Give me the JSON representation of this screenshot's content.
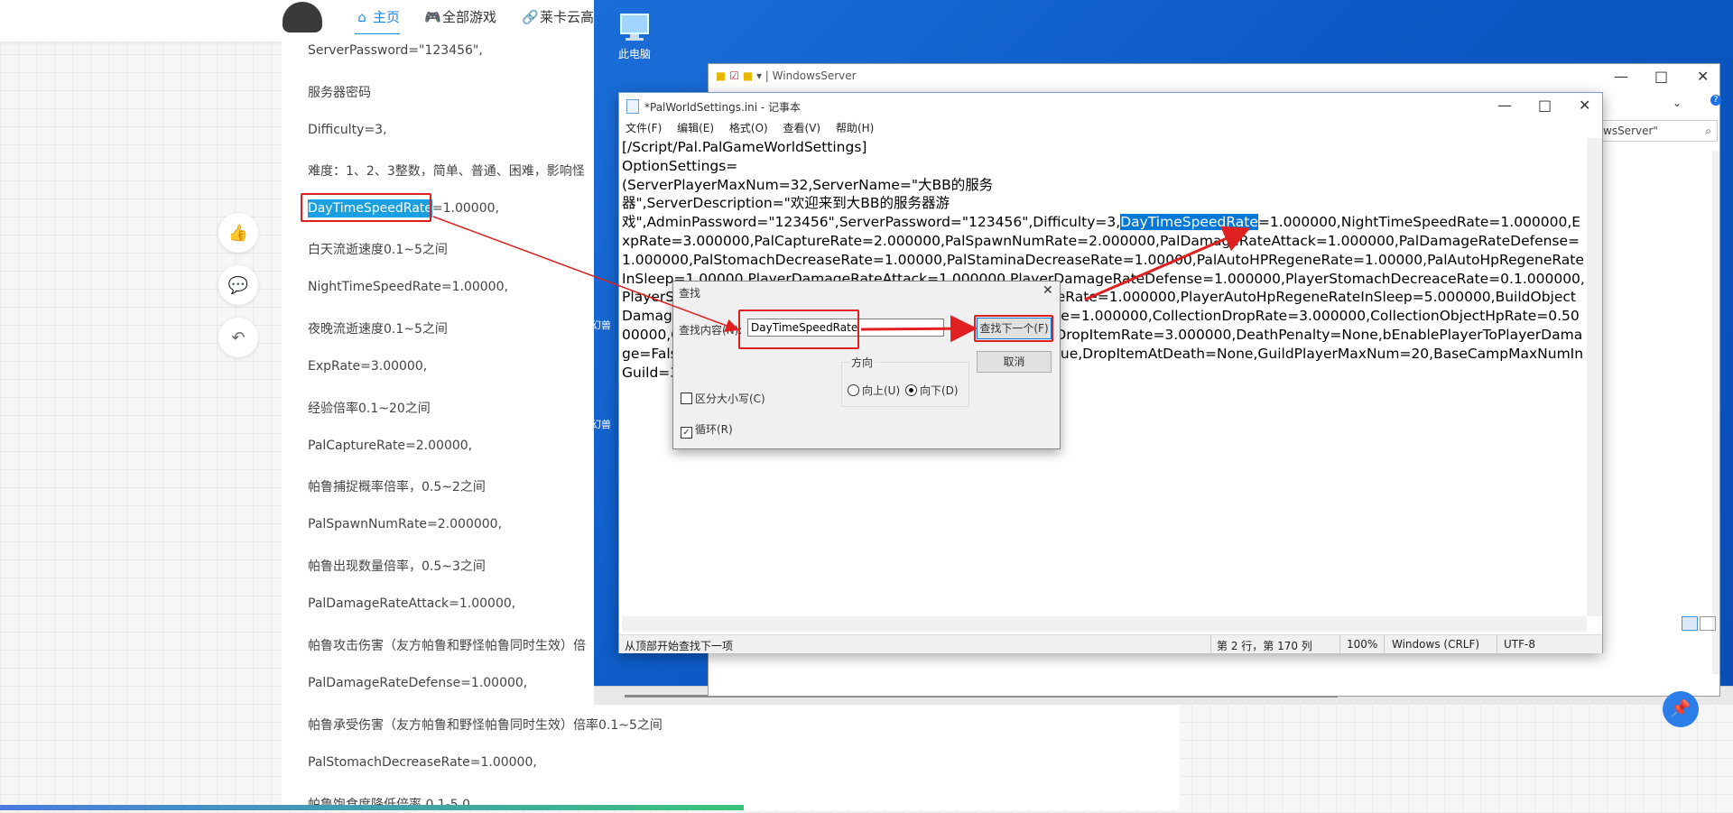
{
  "nav": {
    "home_icon": "home-icon",
    "home_label": "主页",
    "games_icon": "gamepad-icon",
    "games_label": "全部游戏",
    "cloud_icon": "link-icon",
    "cloud_label": "莱卡云高"
  },
  "article": {
    "lines": [
      "ServerPassword=\"123456\",",
      "服务器密码",
      "Difficulty=3,",
      "难度：1、2、3整数，简单、普通、困难，影响怪",
      "DayTimeSpeedRate",
      "=1.00000,",
      "白天流逝速度0.1~5之间",
      "NightTimeSpeedRate=1.00000,",
      "夜晚流逝速度0.1~5之间",
      "ExpRate=3.00000,",
      "经验倍率0.1~20之间",
      "PalCaptureRate=2.00000,",
      "帕鲁捕捉概率倍率，0.5~2之间",
      "PalSpawnNumRate=2.000000,",
      "帕鲁出现数量倍率，0.5~3之间",
      "PalDamageRateAttack=1.00000,",
      "帕鲁攻击伤害（友方帕鲁和野怪帕鲁同时生效）倍",
      "PalDamageRateDefense=1.00000,",
      "帕鲁承受伤害（友方帕鲁和野怪帕鲁同时生效）倍率0.1~5之间",
      "PalStomachDecreaseRate=1.00000,",
      "帕鲁饱食度降低倍率 0.1-5.0"
    ],
    "side_icons": [
      "thumbs-up-icon",
      "comment-icon",
      "share-icon"
    ]
  },
  "desktop": {
    "this_pc_label": "此电脑",
    "icon_label_1": "幻兽",
    "icon_label_2": "幻兽"
  },
  "explorer": {
    "title": "WindowsServer",
    "search_text": "wsServer\""
  },
  "notepad": {
    "title": "*PalWorldSettings.ini - 记事本",
    "menu": [
      "文件(F)",
      "编辑(E)",
      "格式(O)",
      "查看(V)",
      "帮助(H)"
    ],
    "line1": "[/Script/Pal.PalGameWorldSettings]",
    "line2": "OptionSettings=",
    "line3": "(ServerPlayerMaxNum=32,ServerName=\"大BB的服务",
    "line4": "器\",ServerDescription=\"欢迎来到大BB的服务器游",
    "text_before": "戏\",AdminPassword=\"123456\",ServerPassword=\"123456\",Difficulty=3,",
    "text_selected": "DayTimeSpeedRate",
    "text_after": "=1.000000,NightTimeSpeedRate=1.000000,ExpRate=3.000000,PalCaptureRate=2.000000,PalSpawnNumRate=2.000000,PalDamageRateAttack=1.000000,PalDamageRateDefense=1.000000,PalStomachDecreaseRate=1.00000,PalStaminaDecreaseRate=1.00000,PalAutoHPRegeneRate=1.00000,PalAutoHpRegeneRateInSleep=1.00000,PlayerDamageRateAttack=1.000000,PlayerDamageRateDefense=1.000000,PlayerStomachDecreaceRate=0.1.000000,PlayerStaminaDecreaceRate=0.1.000000,PlayerAutoHPRegeneRate=1.000000,PlayerAutoHpRegeneRateInSleep=5.000000,BuildObjectDamageRate=0.5000000,BuildObjectDeteriorationDamageRate=1.000000,CollectionDropRate=3.000000,CollectionObjectHpRate=0.5000000,CollectionObjectRespawnSpeedRate=1.000000,EnemyDropItemRate=3.000000,DeathPenalty=None,bEnablePlayerToPlayerDamage=False,bEnableFriendlyFire=False,bEnableInvaderEnemy=True,DropItemAtDeath=None,GuildPlayerMaxNum=20,BaseCampMaxNumInGuild=3,BaseCampWorkerMaxNum",
    "status": {
      "hint": "从顶部开始查找下一项",
      "position": "第 2 行，第 170 列",
      "zoom": "100%",
      "line_ending": "Windows (CRLF)",
      "encoding": "UTF-8"
    }
  },
  "find_dialog": {
    "title": "查找",
    "label": "查找内容(N):",
    "value": "DayTimeSpeedRate",
    "find_next": "查找下一个(F)",
    "cancel": "取消",
    "direction_label": "方向",
    "up": "向上(U)",
    "down": "向下(D)",
    "match_case": "区分大小写(C)",
    "wrap": "循环(R)",
    "wrap_checked": true,
    "direction_selected": "down"
  },
  "colors": {
    "accent": "#1e88e5",
    "annotation_red": "#e02020",
    "selection": "#0078d7",
    "desktop": "#0c59c5"
  }
}
